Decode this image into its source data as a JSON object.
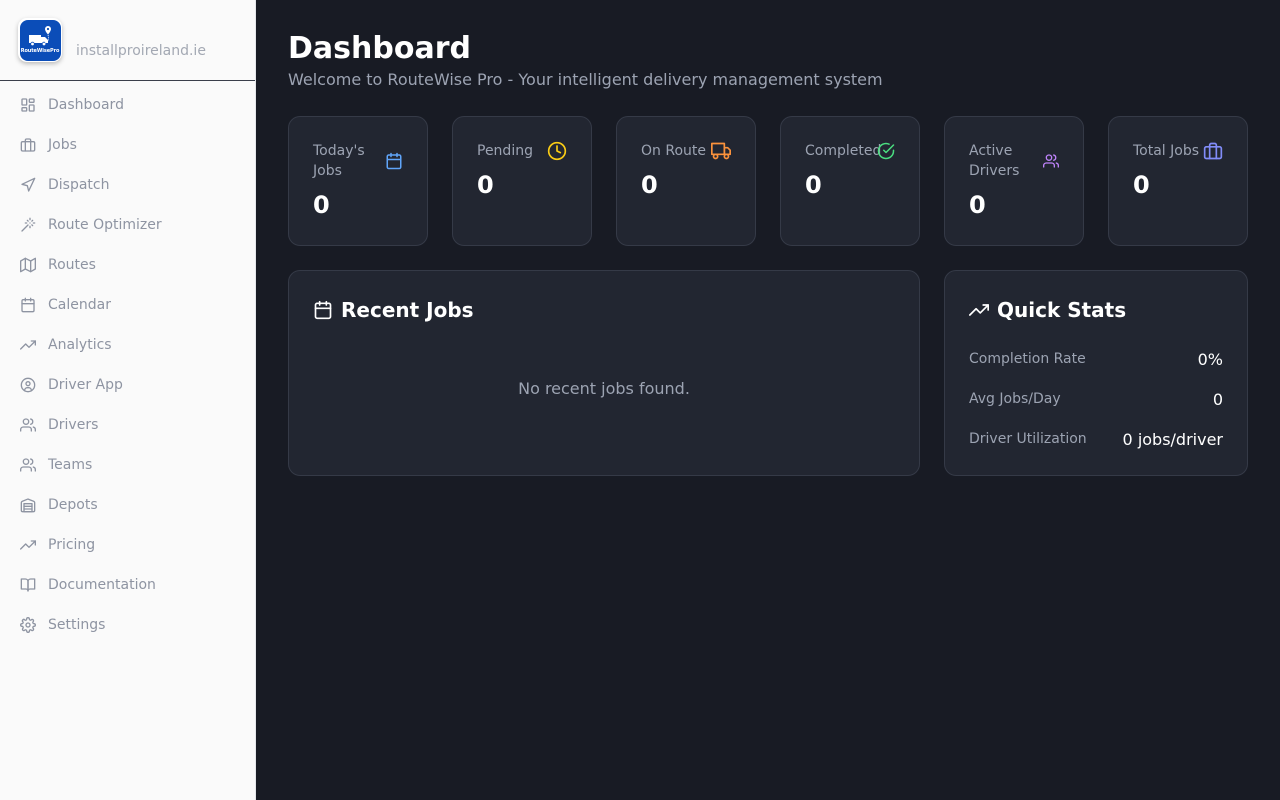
{
  "sidebar": {
    "logo_text": "RouteWisePro",
    "domain": "installproireland.ie",
    "items": [
      {
        "label": "Dashboard",
        "icon": "dashboard-grid-icon"
      },
      {
        "label": "Jobs",
        "icon": "briefcase-icon"
      },
      {
        "label": "Dispatch",
        "icon": "send-icon"
      },
      {
        "label": "Route Optimizer",
        "icon": "magic-wand-icon"
      },
      {
        "label": "Routes",
        "icon": "map-icon"
      },
      {
        "label": "Calendar",
        "icon": "calendar-icon"
      },
      {
        "label": "Analytics",
        "icon": "trending-up-icon"
      },
      {
        "label": "Driver App",
        "icon": "user-circle-icon"
      },
      {
        "label": "Drivers",
        "icon": "users-icon"
      },
      {
        "label": "Teams",
        "icon": "users-icon"
      },
      {
        "label": "Depots",
        "icon": "warehouse-icon"
      },
      {
        "label": "Pricing",
        "icon": "trending-up-icon"
      },
      {
        "label": "Documentation",
        "icon": "book-open-icon"
      },
      {
        "label": "Settings",
        "icon": "gear-icon"
      }
    ]
  },
  "header": {
    "title": "Dashboard",
    "subtitle": "Welcome to RouteWise Pro - Your intelligent delivery management system"
  },
  "stats": [
    {
      "label": "Today's Jobs",
      "value": "0",
      "icon": "calendar-icon",
      "color": "#60a5fa"
    },
    {
      "label": "Pending",
      "value": "0",
      "icon": "clock-icon",
      "color": "#facc15"
    },
    {
      "label": "On Route",
      "value": "0",
      "icon": "truck-icon",
      "color": "#fb923c"
    },
    {
      "label": "Completed",
      "value": "0",
      "icon": "check-circle-icon",
      "color": "#4ade80"
    },
    {
      "label": "Active Drivers",
      "value": "0",
      "icon": "users-icon",
      "color": "#c084fc"
    },
    {
      "label": "Total Jobs",
      "value": "0",
      "icon": "briefcase-icon",
      "color": "#818cf8"
    }
  ],
  "recent_jobs": {
    "title": "Recent Jobs",
    "empty": "No recent jobs found."
  },
  "quick_stats": {
    "title": "Quick Stats",
    "rows": [
      {
        "label": "Completion Rate",
        "value": "0%"
      },
      {
        "label": "Avg Jobs/Day",
        "value": "0"
      },
      {
        "label": "Driver Utilization",
        "value": "0 jobs/driver"
      }
    ]
  },
  "colors": {
    "sidebar_bg": "#fafafa",
    "main_bg": "#181b24",
    "card_bg": "#222631",
    "brand": "#0b4db8"
  }
}
